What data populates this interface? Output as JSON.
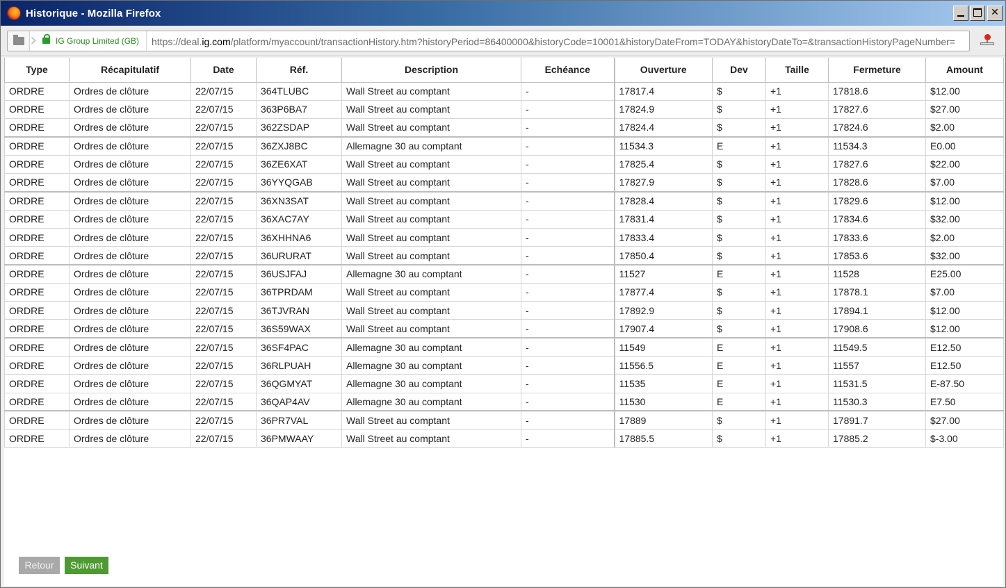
{
  "window": {
    "title": "Historique - Mozilla Firefox",
    "buttons": {
      "minimize": "_",
      "maximize": "□",
      "close": "✕"
    }
  },
  "urlbar": {
    "identity": "IG Group Limited (GB)",
    "url_prefix": "https://deal.",
    "url_domain": "ig.com",
    "url_rest": "/platform/myaccount/transactionHistory.htm?historyPeriod=86400000&historyCode=10001&historyDateFrom=TODAY&historyDateTo=&transactionHistoryPageNumber="
  },
  "table": {
    "headers": [
      "Type",
      "Récapitulatif",
      "Date",
      "Réf.",
      "Description",
      "Echéance",
      "Ouverture",
      "Dev",
      "Taille",
      "Fermeture",
      "Amount"
    ],
    "rows": [
      [
        "ORDRE",
        "Ordres de clôture",
        "22/07/15",
        "364TLUBC",
        "Wall Street au comptant",
        "-",
        "17817.4",
        "$",
        "+1",
        "17818.6",
        "$12.00"
      ],
      [
        "ORDRE",
        "Ordres de clôture",
        "22/07/15",
        "363P6BA7",
        "Wall Street au comptant",
        "-",
        "17824.9",
        "$",
        "+1",
        "17827.6",
        "$27.00"
      ],
      [
        "ORDRE",
        "Ordres de clôture",
        "22/07/15",
        "362ZSDAP",
        "Wall Street au comptant",
        "-",
        "17824.4",
        "$",
        "+1",
        "17824.6",
        "$2.00"
      ],
      [
        "ORDRE",
        "Ordres de clôture",
        "22/07/15",
        "36ZXJ8BC",
        "Allemagne 30 au comptant",
        "-",
        "11534.3",
        "E",
        "+1",
        "11534.3",
        "E0.00"
      ],
      [
        "ORDRE",
        "Ordres de clôture",
        "22/07/15",
        "36ZE6XAT",
        "Wall Street au comptant",
        "-",
        "17825.4",
        "$",
        "+1",
        "17827.6",
        "$22.00"
      ],
      [
        "ORDRE",
        "Ordres de clôture",
        "22/07/15",
        "36YYQGAB",
        "Wall Street au comptant",
        "-",
        "17827.9",
        "$",
        "+1",
        "17828.6",
        "$7.00"
      ],
      [
        "ORDRE",
        "Ordres de clôture",
        "22/07/15",
        "36XN3SAT",
        "Wall Street au comptant",
        "-",
        "17828.4",
        "$",
        "+1",
        "17829.6",
        "$12.00"
      ],
      [
        "ORDRE",
        "Ordres de clôture",
        "22/07/15",
        "36XAC7AY",
        "Wall Street au comptant",
        "-",
        "17831.4",
        "$",
        "+1",
        "17834.6",
        "$32.00"
      ],
      [
        "ORDRE",
        "Ordres de clôture",
        "22/07/15",
        "36XHHNA6",
        "Wall Street au comptant",
        "-",
        "17833.4",
        "$",
        "+1",
        "17833.6",
        "$2.00"
      ],
      [
        "ORDRE",
        "Ordres de clôture",
        "22/07/15",
        "36URURAT",
        "Wall Street au comptant",
        "-",
        "17850.4",
        "$",
        "+1",
        "17853.6",
        "$32.00"
      ],
      [
        "ORDRE",
        "Ordres de clôture",
        "22/07/15",
        "36USJFAJ",
        "Allemagne 30 au comptant",
        "-",
        "11527",
        "E",
        "+1",
        "11528",
        "E25.00"
      ],
      [
        "ORDRE",
        "Ordres de clôture",
        "22/07/15",
        "36TPRDAM",
        "Wall Street au comptant",
        "-",
        "17877.4",
        "$",
        "+1",
        "17878.1",
        "$7.00"
      ],
      [
        "ORDRE",
        "Ordres de clôture",
        "22/07/15",
        "36TJVRAN",
        "Wall Street au comptant",
        "-",
        "17892.9",
        "$",
        "+1",
        "17894.1",
        "$12.00"
      ],
      [
        "ORDRE",
        "Ordres de clôture",
        "22/07/15",
        "36S59WAX",
        "Wall Street au comptant",
        "-",
        "17907.4",
        "$",
        "+1",
        "17908.6",
        "$12.00"
      ],
      [
        "ORDRE",
        "Ordres de clôture",
        "22/07/15",
        "36SF4PAC",
        "Allemagne 30 au comptant",
        "-",
        "11549",
        "E",
        "+1",
        "11549.5",
        "E12.50"
      ],
      [
        "ORDRE",
        "Ordres de clôture",
        "22/07/15",
        "36RLPUAH",
        "Allemagne 30 au comptant",
        "-",
        "11556.5",
        "E",
        "+1",
        "11557",
        "E12.50"
      ],
      [
        "ORDRE",
        "Ordres de clôture",
        "22/07/15",
        "36QGMYAT",
        "Allemagne 30 au comptant",
        "-",
        "11535",
        "E",
        "+1",
        "11531.5",
        "E-87.50"
      ],
      [
        "ORDRE",
        "Ordres de clôture",
        "22/07/15",
        "36QAP4AV",
        "Allemagne 30 au comptant",
        "-",
        "11530",
        "E",
        "+1",
        "11530.3",
        "E7.50"
      ],
      [
        "ORDRE",
        "Ordres de clôture",
        "22/07/15",
        "36PR7VAL",
        "Wall Street au comptant",
        "-",
        "17889",
        "$",
        "+1",
        "17891.7",
        "$27.00"
      ],
      [
        "ORDRE",
        "Ordres de clôture",
        "22/07/15",
        "36PMWAAY",
        "Wall Street au comptant",
        "-",
        "17885.5",
        "$",
        "+1",
        "17885.2",
        "$-3.00"
      ]
    ]
  },
  "pagination": {
    "back_label": "Retour",
    "next_label": "Suivant"
  }
}
